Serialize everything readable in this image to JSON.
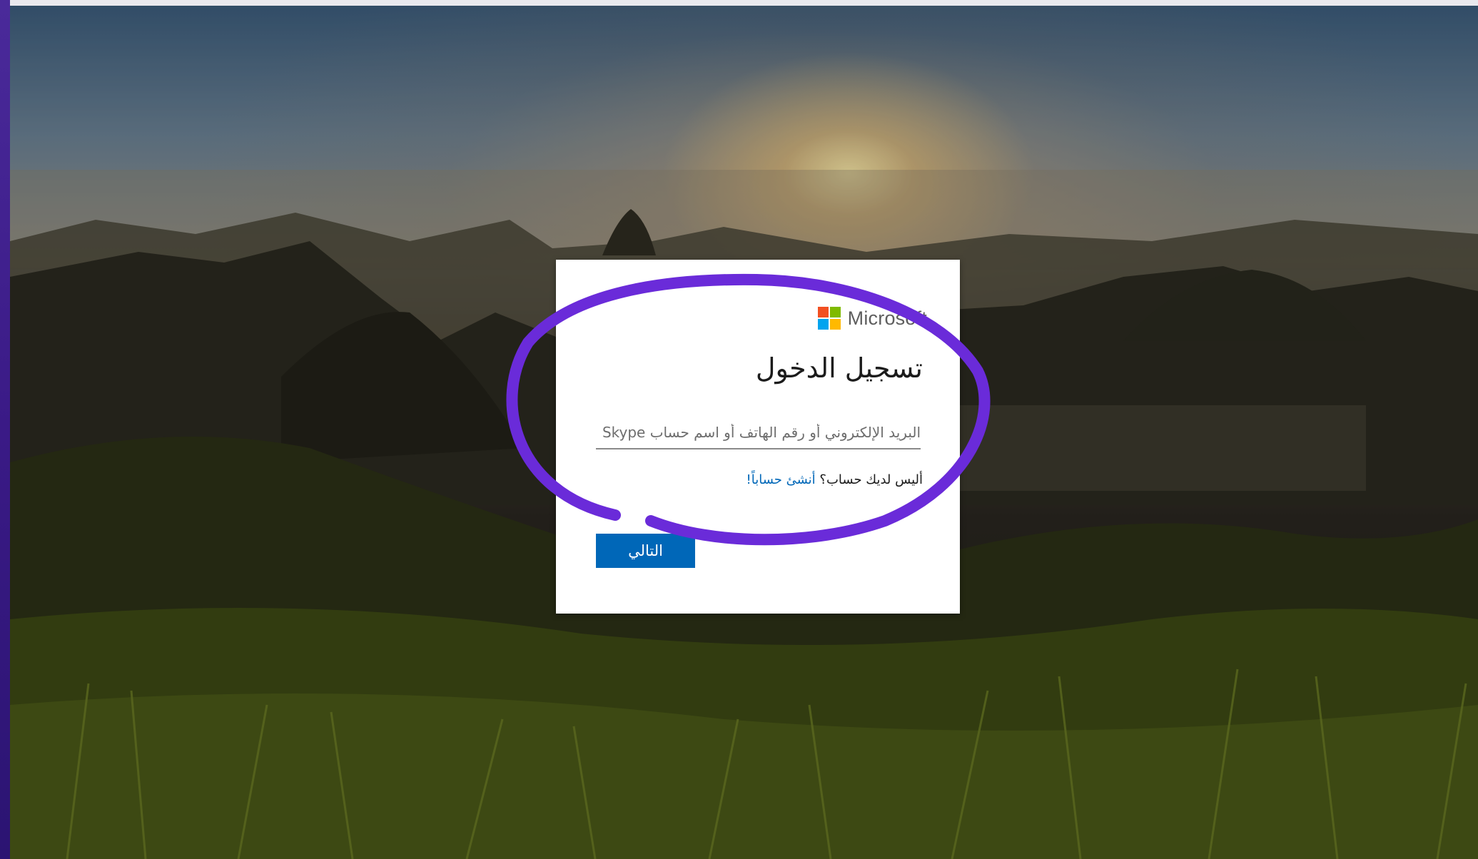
{
  "brand": {
    "logo_text": "Microsoft",
    "logo_colors": [
      "#f25022",
      "#7fba00",
      "#00a4ef",
      "#ffb900"
    ]
  },
  "signin": {
    "title": "تسجيل الدخول",
    "input_placeholder": "البريد الإلكتروني أو رقم الهاتف أو اسم حساب Skype",
    "no_account_text": "أليس لديك حساب؟",
    "create_account_link": "أنشئ حساباً!",
    "next_button": "التالي"
  },
  "colors": {
    "accent": "#0067b8",
    "annotation": "#6a2bd9"
  }
}
